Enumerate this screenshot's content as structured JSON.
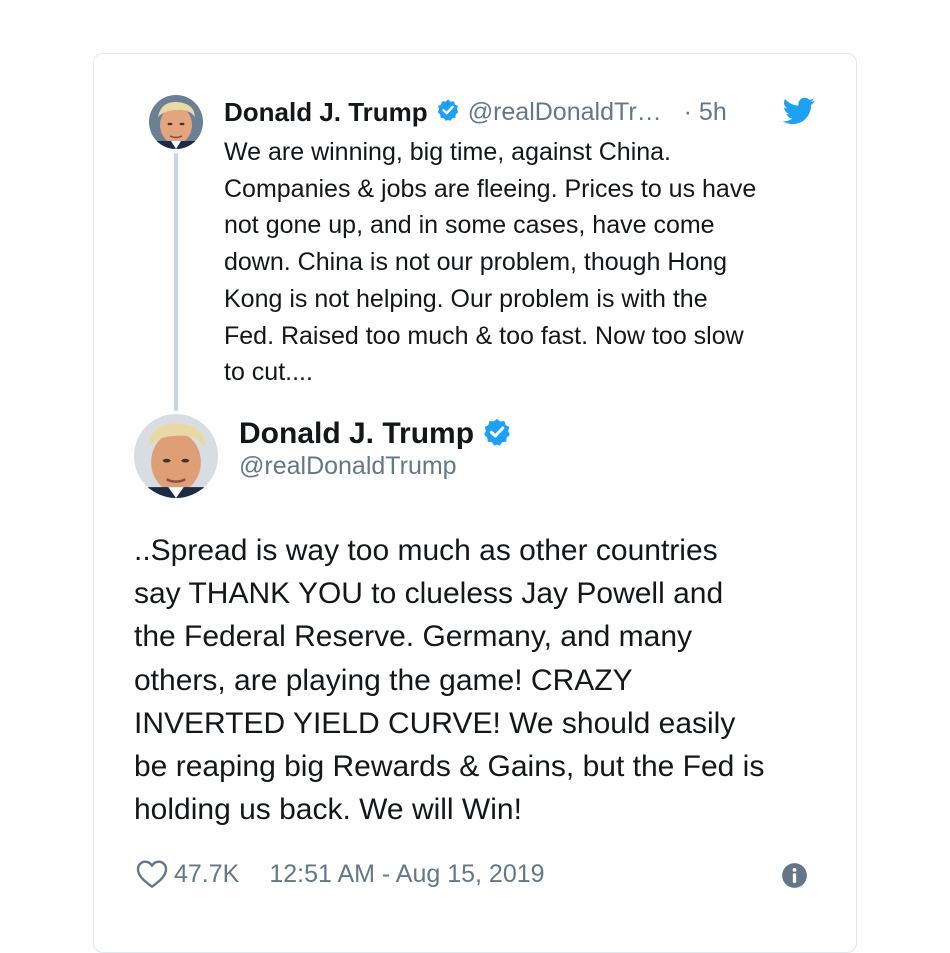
{
  "parent_tweet": {
    "display_name": "Donald J. Trump",
    "handle": "@realDonaldTr…",
    "time": "· 5h",
    "text": "We are winning, big time, against China.\nCompanies & jobs are fleeing. Prices to us have\nnot gone up, and in some cases, have come\ndown. China is not our problem, though Hong\nKong is not helping. Our problem is with the\nFed. Raised too much & too fast. Now too slow\nto cut....",
    "verified_icon": "verified-badge-icon",
    "brand_icon": "twitter-bird-icon"
  },
  "main_tweet": {
    "display_name": "Donald J. Trump",
    "handle": "@realDonaldTrump",
    "text": "..Spread is way too much as other countries\nsay THANK YOU to clueless Jay Powell and\nthe Federal Reserve. Germany, and many\nothers, are playing the game! CRAZY\nINVERTED YIELD CURVE! We should easily\nbe reaping big Rewards & Gains, but the Fed is\nholding us back. We will Win!",
    "verified_icon": "verified-badge-icon"
  },
  "footer": {
    "like_icon": "heart-icon",
    "likes": "47.7K",
    "timestamp": "12:51 AM - Aug 15, 2019",
    "info_icon": "info-icon"
  },
  "colors": {
    "accent": "#1da1f2",
    "text_primary": "#14171a",
    "text_secondary": "#657786",
    "border": "#e1e8ed",
    "thread_line": "#ccd6dd"
  }
}
